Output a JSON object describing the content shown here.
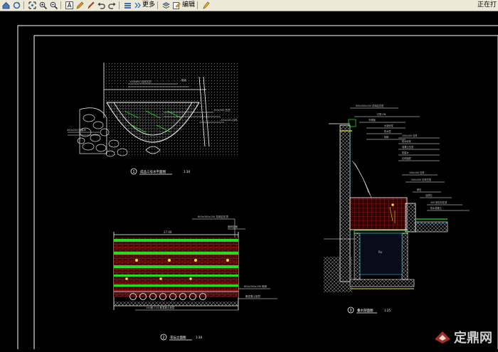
{
  "toolbar": {
    "icons": [
      "home-icon",
      "refresh-icon",
      "zoom-fit-icon",
      "zoom-in-icon",
      "zoom-out-icon",
      "text-icon",
      "pen-icon",
      "brush-icon",
      "undo-icon",
      "redo-icon",
      "stack-icon",
      "more-icon",
      "layers-icon",
      "edit-icon",
      "markup-icon"
    ],
    "more_label": "更多",
    "edit_label": "编辑",
    "status_text": "正在打"
  },
  "drawing": {
    "detail1_title": "成品三号水平面图",
    "detail1_scale": "1:30",
    "detail1_number": "1",
    "detail2_title": "花坛立面图",
    "detail2_scale": "1:30",
    "detail2_number": "2",
    "detail3_title": "叠水剖面图",
    "detail3_scale": "1:25",
    "detail3_number": "3"
  },
  "watermark": {
    "text": "定鼎网",
    "logo_color": "#c0392b"
  },
  "colors": {
    "background": "#000000",
    "line_white": "#ffffff",
    "line_green": "#22dd22",
    "line_red": "#d02020",
    "line_yellow": "#e8e830",
    "line_cyan": "#22cccc"
  }
}
